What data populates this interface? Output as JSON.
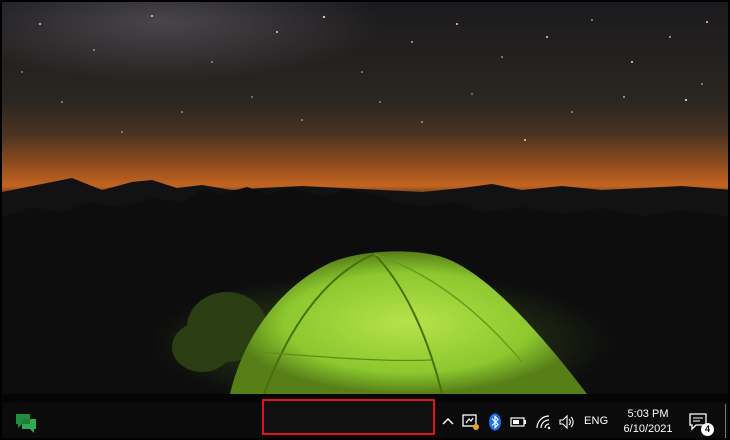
{
  "desktop": {
    "wallpaper": "night sky over mountains with glowing green tent"
  },
  "taskbar": {
    "pinned_apps": [
      {
        "icon": "google-chat-icon",
        "color": "#1e8e3e"
      }
    ],
    "highlight_box_color": "#e0141c",
    "tray": {
      "overflow_icon": "chevron-up-icon",
      "icons": [
        "app-tray-icon",
        "bluetooth-icon",
        "battery-icon",
        "wifi-icon",
        "volume-icon"
      ],
      "language": "ENG",
      "time": "5:03 PM",
      "date": "6/10/2021",
      "notification_count": "4"
    }
  }
}
